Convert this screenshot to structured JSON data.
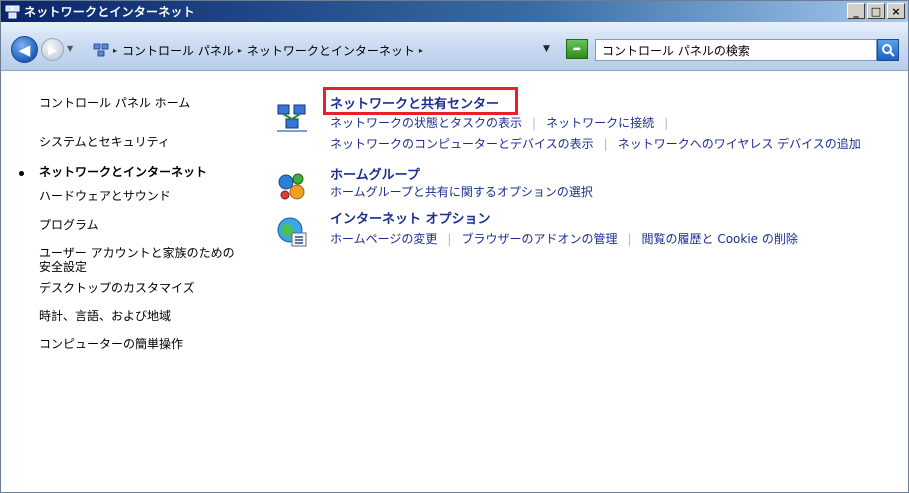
{
  "window": {
    "title": "ネットワークとインターネット",
    "minimize": "_",
    "maximize": "□",
    "close": "×"
  },
  "address": {
    "crumbs": [
      "コントロール パネル",
      "ネットワークとインターネット"
    ],
    "search_placeholder": "コントロール パネルの検索"
  },
  "sidebar": {
    "items": [
      {
        "label": "コントロール パネル ホーム",
        "active": false
      },
      {
        "label": "システムとセキュリティ",
        "active": false
      },
      {
        "label": "ネットワークとインターネット",
        "active": true
      },
      {
        "label": "ハードウェアとサウンド",
        "active": false
      },
      {
        "label": "プログラム",
        "active": false
      },
      {
        "label": "ユーザー アカウントと家族のための",
        "active": false
      },
      {
        "label": "安全設定",
        "active": false
      },
      {
        "label": "デスクトップのカスタマイズ",
        "active": false
      },
      {
        "label": "時計、言語、および地域",
        "active": false
      },
      {
        "label": "コンピューターの簡単操作",
        "active": false
      }
    ]
  },
  "categories": [
    {
      "title": "ネットワークと共有センター",
      "links": [
        [
          "ネットワークの状態とタスクの表示",
          "ネットワークに接続"
        ],
        [
          "ネットワークのコンピューターとデバイスの表示",
          "ネットワークへのワイヤレス デバイスの追加"
        ]
      ]
    },
    {
      "title": "ホームグループ",
      "links": [
        [
          "ホームグループと共有に関するオプションの選択"
        ]
      ]
    },
    {
      "title": "インターネット オプション",
      "links": [
        [
          "ホームページの変更",
          "ブラウザーのアドオンの管理",
          "閲覧の履歴と Cookie の削除"
        ]
      ]
    }
  ],
  "colors": {
    "link": "#1b2e8f",
    "highlight": "#e8202a",
    "titlebar_start": "#0a246a"
  }
}
